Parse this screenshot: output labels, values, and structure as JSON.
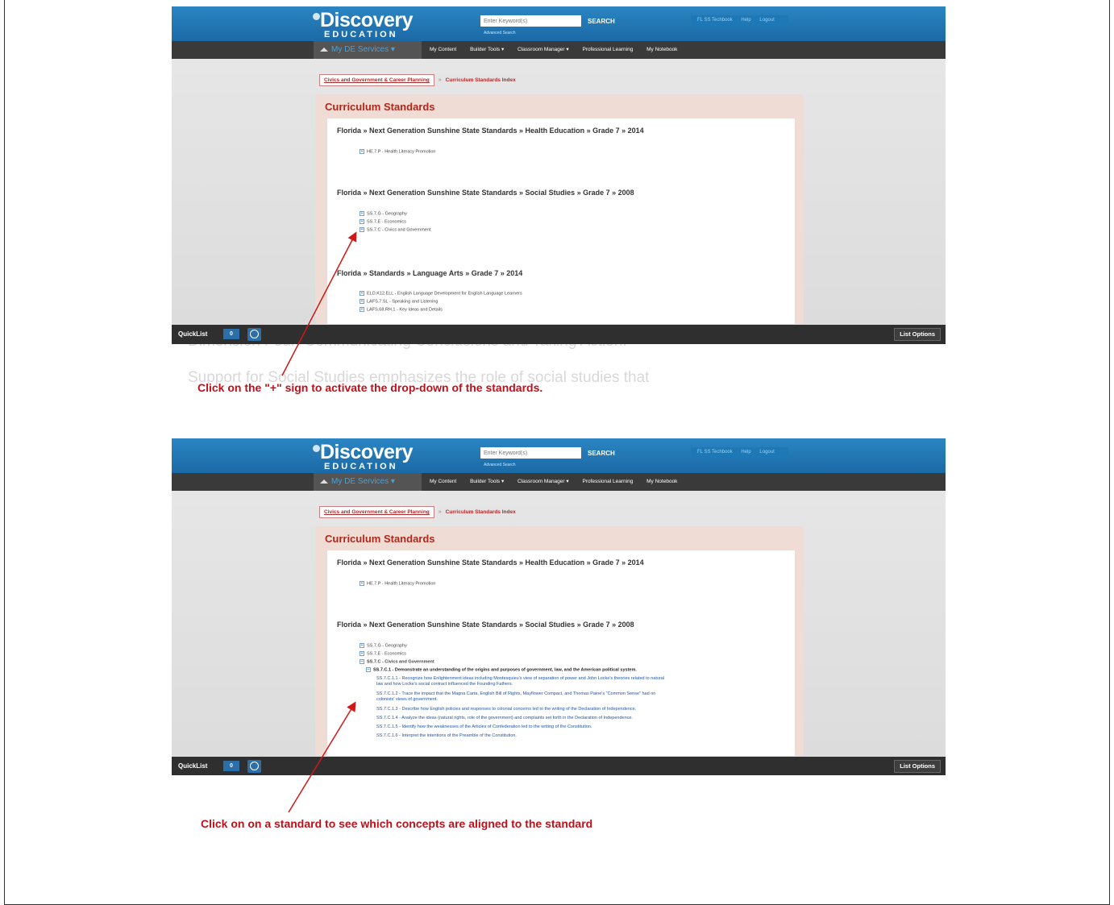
{
  "captions": {
    "top": "Click on the \"+\" sign to activate the drop-down of the standards.",
    "bottom": "Click on on a standard to see which concepts are aligned to the standard"
  },
  "site": {
    "logo_main": "Discovery",
    "logo_sub": "EDUCATION",
    "search_placeholder": "Enter Keyword(s)",
    "search_button": "SEARCH",
    "advanced_search": "Advanced Search",
    "util_links": [
      "FL SS Techbook",
      "Help",
      "Logout"
    ],
    "nav_home": "My DE Services",
    "nav_items": [
      "My Content",
      "Builder Tools ▾",
      "Classroom Manager ▾",
      "Professional Learning",
      "My Notebook"
    ],
    "breadcrumb_link": "Civics and Government & Career Planning",
    "breadcrumb_sep": "»",
    "breadcrumb_current": "Curriculum Standards Index",
    "panel_title": "Curriculum Standards",
    "quicklist_label": "QuickList",
    "quicklist_count": "0",
    "list_options": "List Options"
  },
  "shot1": {
    "heading_health": "Florida » Next Generation Sunshine State Standards » Health Education » Grade 7 » 2014",
    "health_items": [
      "HE.7.P - Health Literacy Promotion"
    ],
    "heading_social": "Florida » Next Generation Sunshine State Standards » Social Studies » Grade 7 » 2008",
    "social_items": [
      "SS.7.G - Geography",
      "SS.7.E - Economics",
      "SS.7.C - Civics and Government"
    ],
    "heading_lang": "Florida » Standards » Language Arts » Grade 7 » 2014",
    "lang_items": [
      "ELD.K12.ELL - English Language Development for English Language Learners",
      "LAFS.7.SL - Speaking and Listening",
      "LAFS.68.RH.1 - Key Ideas and Details"
    ]
  },
  "shot2": {
    "heading_health": "Florida » Next Generation Sunshine State Standards » Health Education » Grade 7 » 2014",
    "health_items": [
      "HE.7.P - Health Literacy Promotion"
    ],
    "heading_social": "Florida » Next Generation Sunshine State Standards » Social Studies » Grade 7 » 2008",
    "social_items": [
      "SS.7.G - Geography",
      "SS.7.E - Economics",
      "SS.7.C - Civics and Government"
    ],
    "sub_heading": "SS.7.C.1 - Demonstrate an understanding of the origins and purposes of government, law, and the American political system.",
    "benchmarks": [
      "SS.7.C.1.1 - Recognize how Enlightenment ideas including Montesquieu's view of separation of power and John Locke's theories related to natural",
      "law and how Locke's social contract influenced the Founding Fathers.",
      "SS.7.C.1.2 - Trace the impact that the Magna Carta, English Bill of Rights, Mayflower Compact, and Thomas Paine's \"Common Sense\" had on",
      "colonists' views of government.",
      "SS.7.C.1.3 - Describe how English policies and responses to colonial concerns led to the writing of the Declaration of Independence.",
      "SS.7.C.1.4 - Analyze the ideas (natural rights, role of the government) and complaints set forth in the Declaration of Independence.",
      "SS.7.C.1.5 - Identify how the weaknesses of the Articles of Confederation led to the writing of the Constitution.",
      "SS.7.C.1.6 - Interpret the intentions of the Preamble of the Constitution."
    ]
  },
  "colors": {
    "accent_red": "#c0101a",
    "brand_blue": "#1b6aa6"
  }
}
